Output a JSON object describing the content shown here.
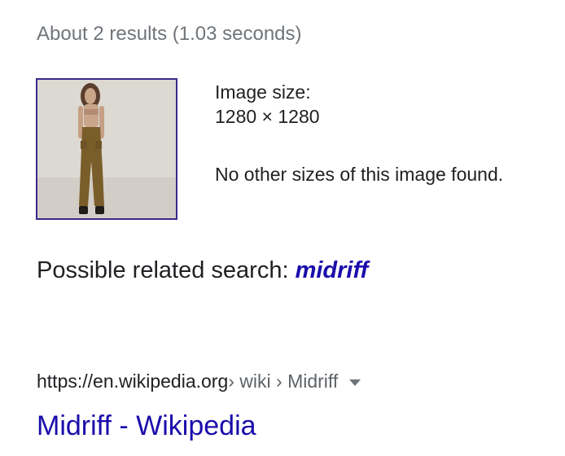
{
  "result_stats": "About 2 results (1.03 seconds)",
  "image_info": {
    "size_label": "Image size:",
    "size_value": "1280 × 1280",
    "no_other_sizes": "No other sizes of this image found."
  },
  "related_search": {
    "label": "Possible related search: ",
    "query": "midriff"
  },
  "result": {
    "domain": "https://en.wikipedia.org",
    "path": " › wiki › Midriff",
    "title": "Midriff - Wikipedia",
    "menu_icon": "caret-down-icon"
  },
  "colors": {
    "link": "#1a0dab",
    "thumb_border": "#3b2a8c",
    "secondary_text": "#70757a"
  }
}
